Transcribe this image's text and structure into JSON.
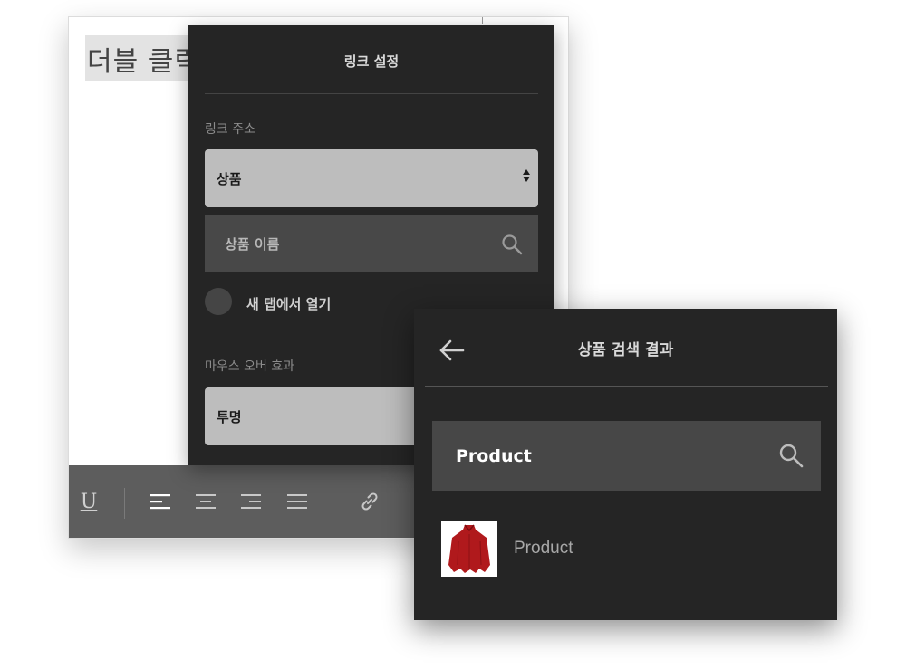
{
  "editor": {
    "text": "더블 클릭"
  },
  "toolbar": {
    "underline_label": "U"
  },
  "link_settings": {
    "title": "링크 설정",
    "link_address_label": "링크 주소",
    "link_type_value": "상품",
    "search_placeholder": "상품 이름",
    "new_tab_label": "새 탭에서 열기",
    "hover_effect_label": "마우스 오버 효과",
    "hover_effect_value": "투명"
  },
  "search_results": {
    "title": "상품 검색 결과",
    "query": "Product",
    "items": [
      {
        "name": "Product",
        "thumbnail_icon": "red-poncho-icon"
      }
    ]
  },
  "colors": {
    "panel_bg": "#252525",
    "toolbar_bg": "#5d5d5d",
    "select_bg": "#bdbdbd",
    "thumbnail_product": "#b0191c"
  }
}
